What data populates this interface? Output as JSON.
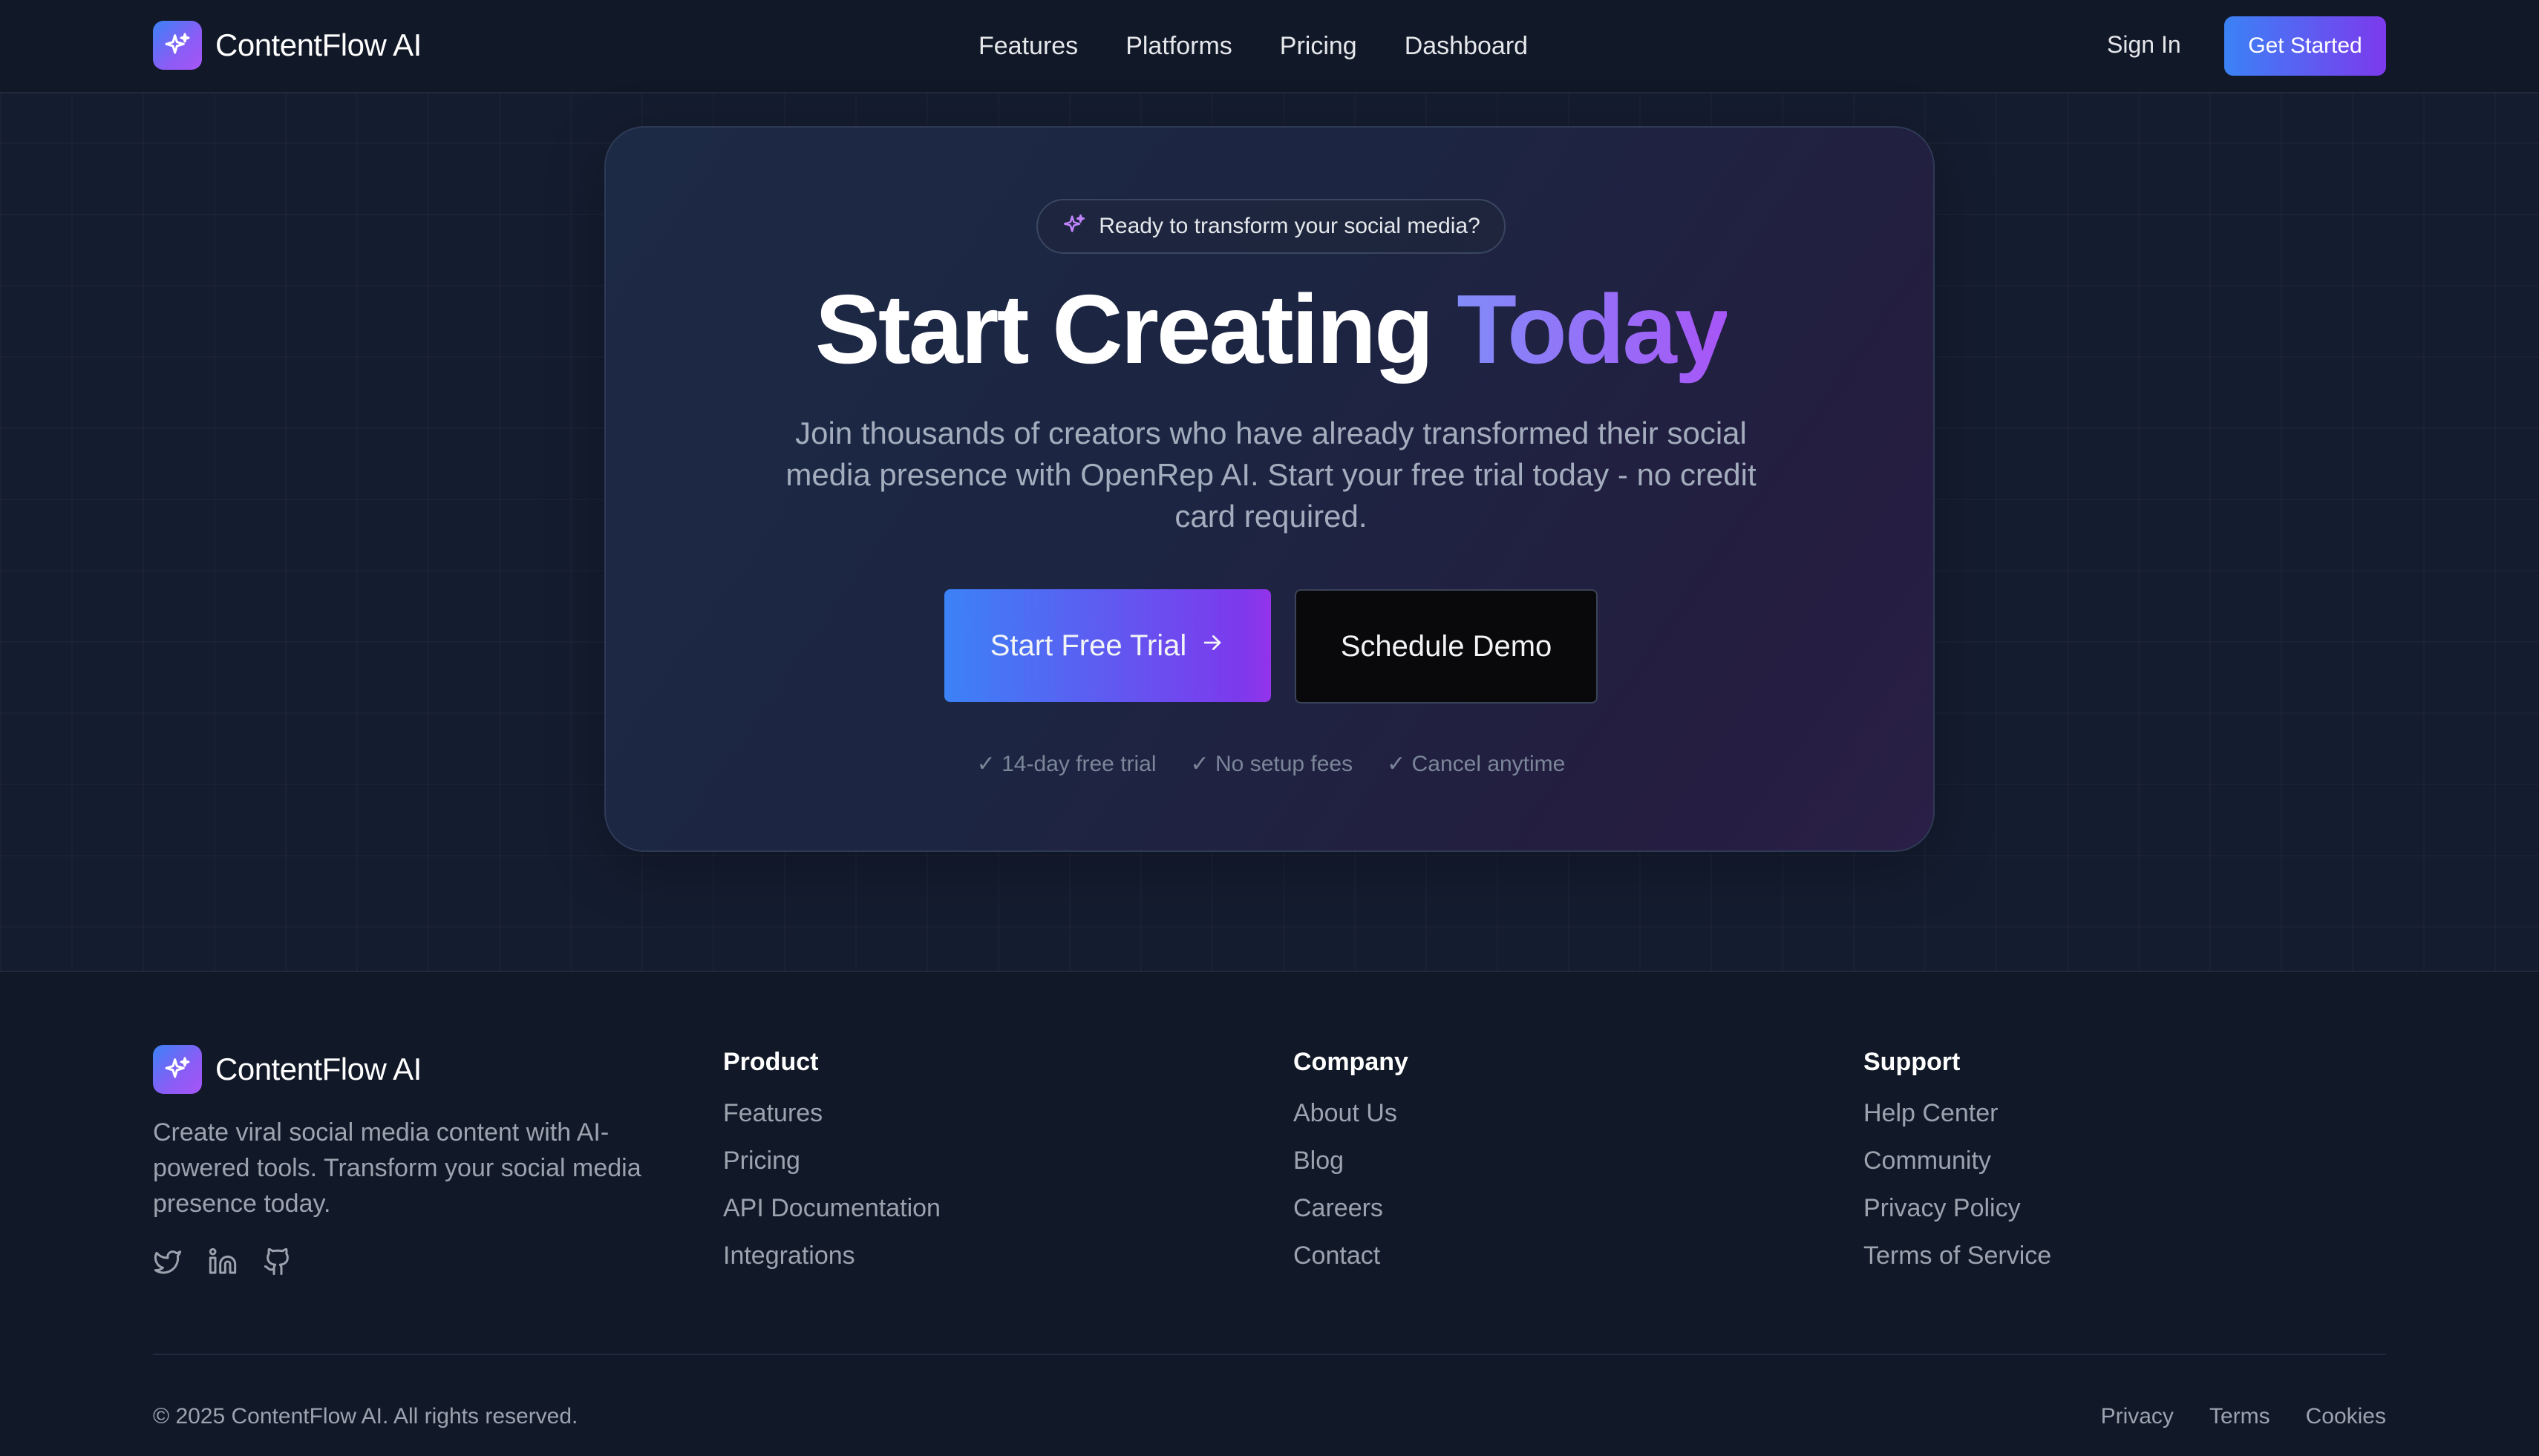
{
  "brand": {
    "name": "ContentFlow AI",
    "logo_icon": "sparkles-icon"
  },
  "nav": {
    "links": [
      "Features",
      "Platforms",
      "Pricing",
      "Dashboard"
    ],
    "sign_in": "Sign In",
    "get_started": "Get Started"
  },
  "hero": {
    "badge": "Ready to transform your social media?",
    "title_main": "Start Creating",
    "title_accent": "Today",
    "description": "Join thousands of creators who have already transformed their social media presence with OpenRep AI. Start your free trial today - no credit card required.",
    "primary_button": "Start Free Trial",
    "secondary_button": "Schedule Demo",
    "perks": [
      "✓ 14-day free trial",
      "✓ No setup fees",
      "✓ Cancel anytime"
    ]
  },
  "footer": {
    "description": "Create viral social media content with AI-powered tools. Transform your social media presence today.",
    "socials": [
      "twitter-icon",
      "linkedin-icon",
      "github-icon"
    ],
    "columns": [
      {
        "title": "Product",
        "links": [
          "Features",
          "Pricing",
          "API Documentation",
          "Integrations"
        ]
      },
      {
        "title": "Company",
        "links": [
          "About Us",
          "Blog",
          "Careers",
          "Contact"
        ]
      },
      {
        "title": "Support",
        "links": [
          "Help Center",
          "Community",
          "Privacy Policy",
          "Terms of Service"
        ]
      }
    ],
    "copyright": "© 2025 ContentFlow AI. All rights reserved.",
    "legal": [
      "Privacy",
      "Terms",
      "Cookies"
    ]
  },
  "colors": {
    "background": "#131b2e",
    "accent_blue": "#3b82f6",
    "accent_purple": "#7c3aed",
    "muted_text": "#9ca3af"
  }
}
